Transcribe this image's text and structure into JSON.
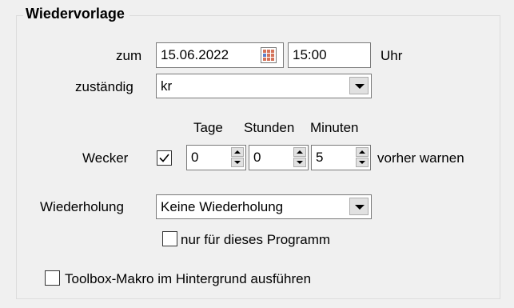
{
  "group": {
    "title": "Wiedervorlage"
  },
  "date_row": {
    "label": "zum",
    "date": "15.06.2022",
    "time": "15:00",
    "unit": "Uhr"
  },
  "responsible": {
    "label": "zuständig",
    "value": "kr"
  },
  "alarm": {
    "label": "Wecker",
    "checked": true,
    "col_days": "Tage",
    "col_hours": "Stunden",
    "col_minutes": "Minuten",
    "days": "0",
    "hours": "0",
    "minutes": "5",
    "suffix": "vorher warnen"
  },
  "repeat": {
    "label": "Wiederholung",
    "value": "Keine Wiederholung"
  },
  "program_only": {
    "label": "nur für dieses Programm",
    "checked": false
  },
  "toolbox": {
    "label": "Toolbox-Makro im Hintergrund ausführen",
    "checked": false
  },
  "icons": {
    "calendar": "calendar-icon",
    "dropdown": "chevron-down-icon",
    "check": "checkmark-icon"
  }
}
